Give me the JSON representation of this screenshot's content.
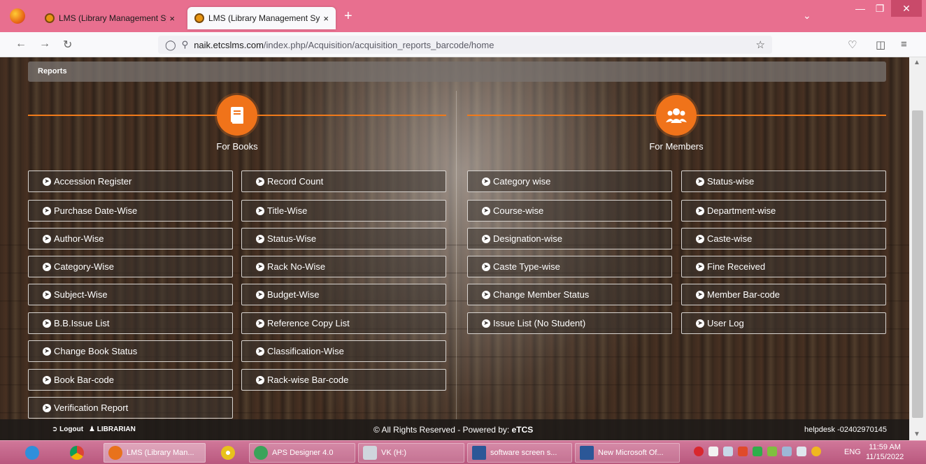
{
  "browser": {
    "tabs": [
      {
        "label": "LMS (Library Management Syst",
        "active": false
      },
      {
        "label": "LMS (Library Management Syst",
        "active": true
      }
    ],
    "tab_close": "×",
    "new_tab": "+",
    "url_host": "naik.etcslms.com",
    "url_path": "/index.php/Acquisition/acquisition_reports_barcode/home"
  },
  "page": {
    "breadcrumb": "Reports",
    "books": {
      "title": "For Books",
      "col1": [
        "Accession Register",
        "Purchase Date-Wise",
        "Author-Wise",
        "Category-Wise",
        "Subject-Wise",
        "B.B.Issue List",
        "Change Book Status",
        "Book Bar-code",
        "Verification Report"
      ],
      "col2": [
        "Record Count",
        "Title-Wise",
        "Status-Wise",
        "Rack No-Wise",
        "Budget-Wise",
        "Reference Copy List",
        "Classification-Wise",
        "Rack-wise Bar-code"
      ]
    },
    "members": {
      "title": "For Members",
      "col1": [
        "Category wise",
        "Course-wise",
        "Designation-wise",
        "Caste Type-wise",
        "Change Member Status",
        "Issue List (No Student)"
      ],
      "col2": [
        "Status-wise",
        "Department-wise",
        "Caste-wise",
        "Fine Received",
        "Member Bar-code",
        "User Log"
      ]
    },
    "footer": {
      "logout": "Logout",
      "role": "LIBRARIAN",
      "copyright_prefix": "© All Rights Reserved - Powered by: ",
      "brand": "eTCS",
      "helpdesk": "helpdesk -02402970145"
    }
  },
  "taskbar": {
    "items": [
      {
        "label": "LMS (Library Man...",
        "color": "#e8721c"
      },
      {
        "label": "APS Designer 4.0",
        "color": "#3aa35a"
      },
      {
        "label": "VK (H:)",
        "color": "#cfd6dd"
      },
      {
        "label": "software screen s...",
        "color": "#2b5797"
      },
      {
        "label": "New Microsoft Of...",
        "color": "#2b5797"
      }
    ],
    "lang": "ENG",
    "time": "11:59 AM",
    "date": "11/15/2022"
  },
  "colors": {
    "accent": "#f0731a",
    "tabbar": "#e86f8f",
    "taskbar": "#c2668a"
  }
}
